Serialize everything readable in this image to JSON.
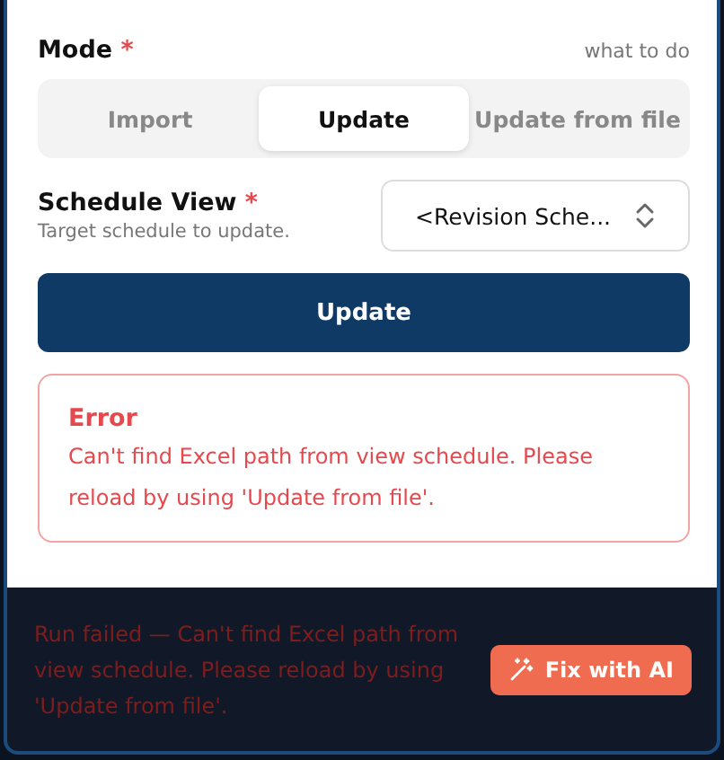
{
  "mode": {
    "label": "Mode",
    "required_mark": "*",
    "hint": "what to do",
    "tabs": [
      {
        "label": "Import",
        "selected": false
      },
      {
        "label": "Update",
        "selected": true
      },
      {
        "label": "Update from file",
        "selected": false
      }
    ]
  },
  "schedule_view": {
    "label": "Schedule View",
    "required_mark": "*",
    "description": "Target schedule to update.",
    "value": "<Revision Sche..."
  },
  "action_button": "Update",
  "error": {
    "title": "Error",
    "message": "Can't find Excel path from view schedule. Please reload by using 'Update from file'."
  },
  "status_bar": {
    "message": "Run failed — Can't find Excel path from view schedule. Please reload by using 'Update from file'.",
    "button": "Fix with AI"
  }
}
